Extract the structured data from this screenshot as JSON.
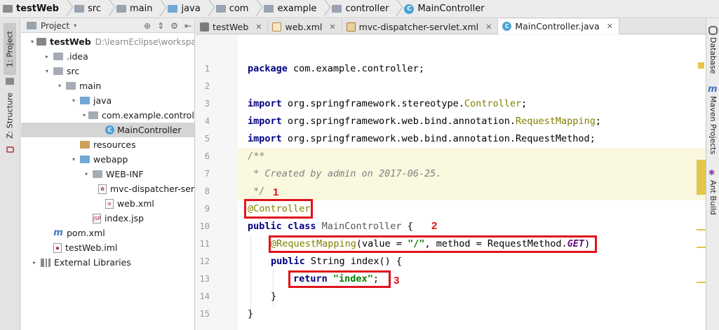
{
  "breadcrumb": [
    "testWeb",
    "src",
    "main",
    "java",
    "com",
    "example",
    "controller",
    "MainController"
  ],
  "left_tools": {
    "project": "1: Project",
    "structure": "Z: Structure"
  },
  "right_tools": {
    "database": "Database",
    "maven": "Maven Projects",
    "ant": "Ant Build"
  },
  "panel": {
    "title": "Project",
    "icon_names": [
      "target-icon",
      "collapse-icon",
      "gear-icon",
      "hide-icon"
    ]
  },
  "tree": [
    {
      "label": "testWeb",
      "path": "D:\\learnEclipse\\workspace_ide",
      "icon": "project-folder-icon",
      "arrow": "▾"
    },
    {
      "label": ".idea",
      "icon": "folder-icon",
      "arrow": "▸"
    },
    {
      "label": "src",
      "icon": "folder-icon",
      "arrow": "▾"
    },
    {
      "label": "main",
      "icon": "folder-icon",
      "arrow": "▾"
    },
    {
      "label": "java",
      "icon": "source-folder-icon",
      "arrow": "▾"
    },
    {
      "label": "com.example.controller",
      "icon": "package-icon",
      "arrow": "▾"
    },
    {
      "label": "MainController",
      "icon": "class-icon",
      "arrow": ""
    },
    {
      "label": "resources",
      "icon": "resources-folder-icon",
      "arrow": ""
    },
    {
      "label": "webapp",
      "icon": "web-folder-icon",
      "arrow": "▾"
    },
    {
      "label": "WEB-INF",
      "icon": "folder-icon",
      "arrow": "▾"
    },
    {
      "label": "mvc-dispatcher-servlet",
      "icon": "spring-xml-icon",
      "arrow": ""
    },
    {
      "label": "web.xml",
      "icon": "xml-file-icon",
      "arrow": ""
    },
    {
      "label": "index.jsp",
      "icon": "jsp-file-icon",
      "arrow": ""
    },
    {
      "label": "pom.xml",
      "icon": "maven-icon",
      "arrow": ""
    },
    {
      "label": "testWeb.iml",
      "icon": "iml-file-icon",
      "arrow": ""
    },
    {
      "label": "External Libraries",
      "icon": "library-icon",
      "arrow": "▸"
    }
  ],
  "tabs": [
    {
      "label": "testWeb"
    },
    {
      "label": "web.xml"
    },
    {
      "label": "mvc-dispatcher-servlet.xml"
    },
    {
      "label": "MainController.java"
    }
  ],
  "lines": [
    "1",
    "2",
    "3",
    "4",
    "5",
    "6",
    "7",
    "8",
    "9",
    "10",
    "11",
    "12",
    "13",
    "14",
    "15"
  ],
  "code": {
    "l1": [
      "package",
      " com.example.controller;"
    ],
    "l3": [
      "import",
      " org.springframework.stereotype.",
      "Controller",
      ";"
    ],
    "l4": [
      "import",
      " org.springframework.web.bind.annotation.",
      "RequestMapping",
      ";"
    ],
    "l5": [
      "import",
      " org.springframework.web.bind.annotation.RequestMethod;"
    ],
    "l6": "/**",
    "l7": " * Created by admin on 2017-06-25.",
    "l8": " */",
    "l9": "@Controller",
    "l10": [
      "public class",
      " MainController ",
      "{"
    ],
    "l11": [
      "@RequestMapping",
      "(value = ",
      "\"/\"",
      ", method = RequestMethod.",
      "GET",
      ")"
    ],
    "l12": [
      "public",
      " String index() {"
    ],
    "l13": [
      "return",
      " ",
      "\"index\"",
      ";"
    ],
    "l14": "}",
    "l15": "}"
  },
  "annotations": [
    "1",
    "2",
    "3"
  ]
}
